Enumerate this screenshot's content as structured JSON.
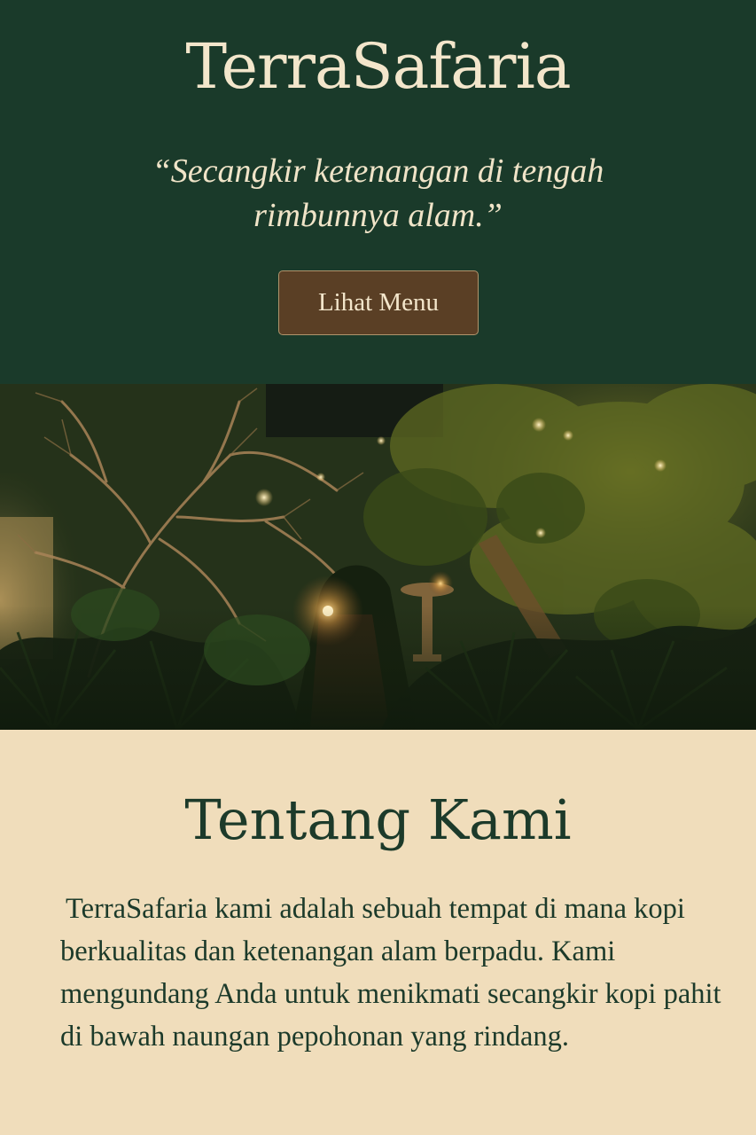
{
  "hero": {
    "brand": "TerraSafaria",
    "tagline": "“Secangkir ketenangan di tengah rimbunnya alam.”",
    "menu_button_label": "Lihat Menu"
  },
  "about": {
    "title": "Tentang Kami",
    "body": "TerraSafaria kami adalah sebuah tempat di mana kopi berkualitas dan ketenangan alam berpadu. Kami mengundang Anda untuk menikmati secangkir kopi pahit di bawah naungan pepohonan yang rindang."
  },
  "colors": {
    "hero_background": "#1a3a2a",
    "button_background": "#5a3f25",
    "cream_background": "#f0ddbb",
    "text_dark_green": "#1c3a2a",
    "text_cream": "#f3e6cb"
  }
}
